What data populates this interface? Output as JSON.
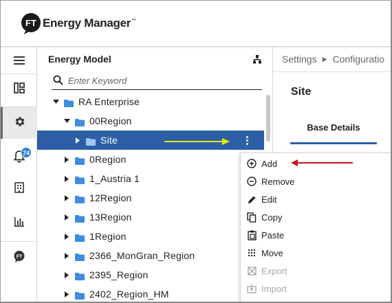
{
  "app": {
    "name": "Energy Manager",
    "trademark": "™",
    "logo_letters": "FT"
  },
  "rail": {
    "items": [
      {
        "icon": "menu-icon"
      },
      {
        "icon": "dashboard-icon"
      },
      {
        "icon": "gear-icon",
        "active": true
      },
      {
        "icon": "bell-icon",
        "badge": "74"
      },
      {
        "icon": "building-icon"
      },
      {
        "icon": "bar-chart-icon"
      },
      {
        "icon": "ft-chat-icon"
      }
    ]
  },
  "tree_panel": {
    "title": "Energy Model",
    "search_placeholder": "Enter Keyword",
    "nodes": [
      {
        "label": "RA Enterprise",
        "expanded": true,
        "level": 0
      },
      {
        "label": "00Region",
        "expanded": true,
        "level": 1
      },
      {
        "label": "Site",
        "expanded": false,
        "level": 2,
        "selected": true
      },
      {
        "label": "0Region",
        "expanded": false,
        "level": 1
      },
      {
        "label": "1_Austria 1",
        "expanded": false,
        "level": 1
      },
      {
        "label": "12Region",
        "expanded": false,
        "level": 1
      },
      {
        "label": "13Region",
        "expanded": false,
        "level": 1
      },
      {
        "label": "1Region",
        "expanded": false,
        "level": 1
      },
      {
        "label": "2366_MonGran_Region",
        "expanded": false,
        "level": 1
      },
      {
        "label": "2395_Region",
        "expanded": false,
        "level": 1
      },
      {
        "label": "2402_Region_HM",
        "expanded": false,
        "level": 1
      }
    ]
  },
  "right_pane": {
    "breadcrumb": [
      "Settings",
      "Configuratio"
    ],
    "title": "Site",
    "tab": "Base Details"
  },
  "context_menu": {
    "items": [
      {
        "label": "Add",
        "icon": "add-circle-icon",
        "enabled": true
      },
      {
        "label": "Remove",
        "icon": "remove-circle-icon",
        "enabled": true
      },
      {
        "label": "Edit",
        "icon": "pencil-icon",
        "enabled": true
      },
      {
        "label": "Copy",
        "icon": "copy-icon",
        "enabled": true
      },
      {
        "label": "Paste",
        "icon": "paste-icon",
        "enabled": true
      },
      {
        "label": "Move",
        "icon": "move-icon",
        "enabled": true
      },
      {
        "label": "Export",
        "icon": "export-icon",
        "enabled": false
      },
      {
        "label": "Import",
        "icon": "import-icon",
        "enabled": false
      }
    ]
  },
  "colors": {
    "selection": "#2d5fa6",
    "folder": "#3d8de0",
    "badge": "#2f7fd3",
    "annotation_yellow": "#e6f000",
    "annotation_red": "#c0181e"
  }
}
